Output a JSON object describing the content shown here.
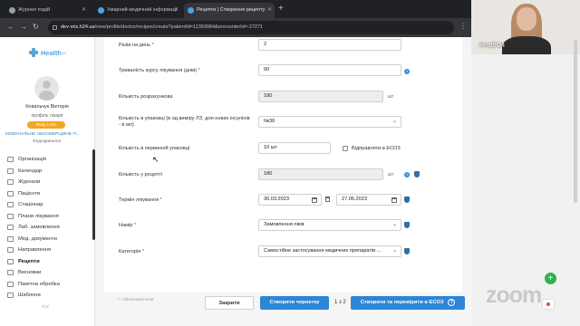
{
  "browser": {
    "tabs": [
      {
        "label": "Журнал подій",
        "active": false
      },
      {
        "label": "Хмарний медичний інформаці",
        "active": false
      },
      {
        "label": "Рецепти | Створення рецепту",
        "active": true
      }
    ],
    "new_tab": "+",
    "url_host": "dev-mis.h24.ua",
    "url_path": "/new/profile/doctor/recipes/create?patientId=11369984&encounterId=-27271",
    "nav": {
      "back": "←",
      "forward": "→",
      "reload": "↻",
      "menu": "⋮"
    }
  },
  "sidebar": {
    "logo_text": "Health",
    "logo_sup": "24",
    "user_name": "Ковальчук Вікторія",
    "user_role": "профіль лікаря",
    "user_badge": "Лікар 1 кат.",
    "org": "КОМУНАЛЬНЕ НЕКОМЕРЦІЙНЕ П...",
    "specialty": "Ендокринолог",
    "items": [
      {
        "label": "Організація",
        "active": false
      },
      {
        "label": "Календар",
        "active": false
      },
      {
        "label": "Журнали",
        "active": false
      },
      {
        "label": "Пацієнти",
        "active": false
      },
      {
        "label": "Стаціонар",
        "active": false
      },
      {
        "label": "Плани лікування",
        "active": false
      },
      {
        "label": "Лаб. замовлення",
        "active": false
      },
      {
        "label": "Мед. документи",
        "active": false
      },
      {
        "label": "Направлення",
        "active": false
      },
      {
        "label": "Рецепти",
        "active": true
      },
      {
        "label": "Висновки",
        "active": false
      },
      {
        "label": "Пакетна обробка",
        "active": false
      },
      {
        "label": "Шаблони",
        "active": false
      }
    ],
    "collapse": "<<"
  },
  "form": {
    "per_day": {
      "label": "Разів на день",
      "value": "2"
    },
    "duration": {
      "label": "Тривалість курсу лікування (днів)",
      "value": "90"
    },
    "calc_qty": {
      "label": "Кількість розрахункова",
      "value": "180",
      "unit": "шт"
    },
    "pack_qty": {
      "label": "Кількість в упаковці (в од.виміру ЛЗ, для нових інсулінів - в мл)",
      "value": "№30"
    },
    "primary_pack": {
      "label": "Кількість в первинній упаковці",
      "value": "10 шт",
      "checkbox_label": "Відправляти в ЕСОЗ"
    },
    "rx_qty": {
      "label": "Кількість у рецепті",
      "value": "180",
      "unit": "шт"
    },
    "term": {
      "label": "Термін лікування",
      "from": "30.03.2023",
      "to": "27.06.2023"
    },
    "intent": {
      "label": "Намір",
      "value": "Замовлення ліків"
    },
    "category": {
      "label": "Категорія",
      "value": "Самостійне застосування медичних препаратів ..."
    }
  },
  "footer": {
    "hint": "- Обов'язкові поля",
    "close": "Закрити",
    "draft": "Створити чернетку",
    "pager": "1 з 2",
    "create_check": "Створити та перевірити в ЕСОЗ",
    "help": "?"
  },
  "video": {
    "participant": "Health24",
    "watermark": "zoom",
    "fab": "+"
  },
  "colors": {
    "primary": "#2d86d6",
    "accent": "#5aa6d6",
    "required": "#dd3333",
    "shield": "#2f6fa8"
  }
}
